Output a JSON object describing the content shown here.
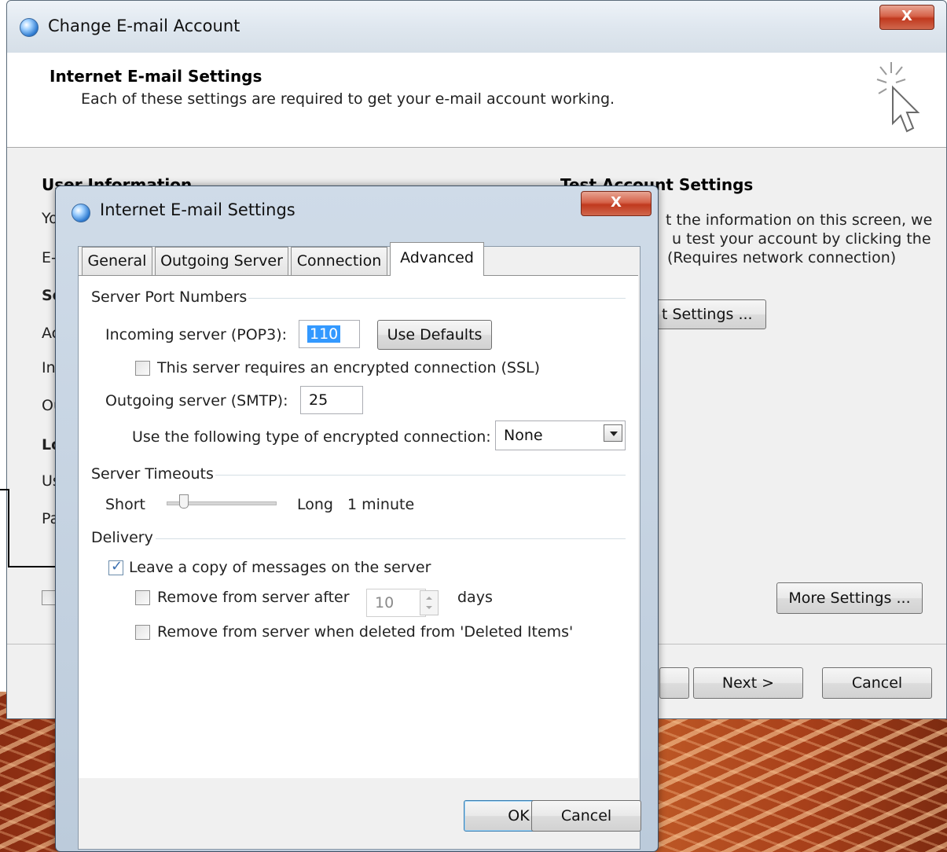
{
  "outer_window": {
    "title": "Change E-mail Account",
    "header_title": "Internet E-mail Settings",
    "header_subtitle": "Each of these settings are required to get your e-mail account working.",
    "user_info_heading": "User Information",
    "test_heading": "Test Account Settings",
    "test_desc_line1": "t the information on this screen, we",
    "test_desc_line2": "u test your account by clicking the",
    "test_desc_line3": "(Requires network connection)",
    "test_button_label": "t Settings ...",
    "more_settings_label": "More Settings ...",
    "next_label": "Next >",
    "cancel_label": "Cancel",
    "partial_labels": [
      "Yo",
      "E-",
      "Se",
      "Ac",
      "In",
      "Ou",
      "Lo",
      "Us",
      "Pa"
    ]
  },
  "inner_dialog": {
    "title": "Internet E-mail Settings",
    "close_label": "X",
    "tabs": [
      {
        "label": "General"
      },
      {
        "label": "Outgoing Server"
      },
      {
        "label": "Connection"
      },
      {
        "label": "Advanced"
      }
    ],
    "server_ports": {
      "group_label": "Server Port Numbers",
      "incoming_label": "Incoming server (POP3):",
      "incoming_value": "110",
      "use_defaults_label": "Use Defaults",
      "ssl_label": "This server requires an encrypted connection (SSL)",
      "ssl_checked": false,
      "outgoing_label": "Outgoing server (SMTP):",
      "outgoing_value": "25",
      "encryption_label": "Use the following type of encrypted connection:",
      "encryption_value": "None"
    },
    "timeouts": {
      "group_label": "Server Timeouts",
      "short_label": "Short",
      "long_label": "Long",
      "value_text": "1 minute",
      "slider_level": 0.15
    },
    "delivery": {
      "group_label": "Delivery",
      "leave_copy_label": "Leave a copy of messages on the server",
      "leave_copy_checked": true,
      "remove_after_label": "Remove from server after",
      "remove_after_value": "10",
      "days_label": "days",
      "remove_deleted_label": "Remove from server when deleted from 'Deleted Items'"
    },
    "ok_label": "OK",
    "cancel_label": "Cancel"
  },
  "outer_close_label": "X"
}
